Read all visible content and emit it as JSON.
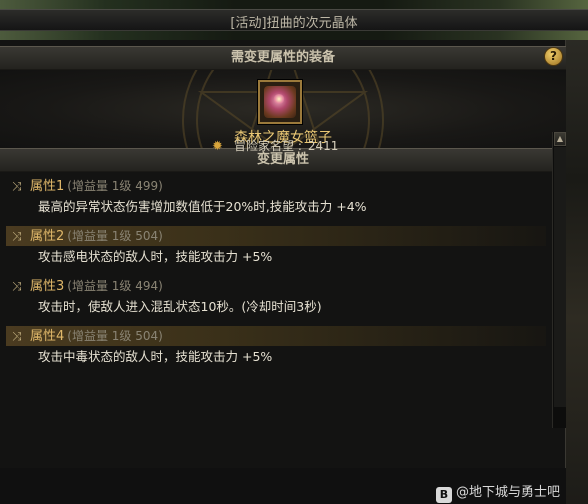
{
  "window": {
    "title": "[活动]扭曲的次元晶体"
  },
  "equip_section": {
    "header": "需变更属性的装备",
    "help_label": "?"
  },
  "item": {
    "name": "森林之魔女篮子",
    "icon": "witch-basket-icon"
  },
  "change_section": {
    "header": "变更属性"
  },
  "fame": {
    "label": "冒险家名望 :",
    "value": "2411",
    "icon": "fame-emblem-icon"
  },
  "attributes": [
    {
      "name": "属性1",
      "meta": "(增益量 1级 499)",
      "desc": "最高的异常状态伤害增加数值低于20%时,技能攻击力 +4%",
      "highlighted": false
    },
    {
      "name": "属性2",
      "meta": "(增益量 1级 504)",
      "desc": "攻击感电状态的敌人时，技能攻击力 +5%",
      "highlighted": true
    },
    {
      "name": "属性3",
      "meta": "(增益量 1级 494)",
      "desc": "攻击时，使敌人进入混乱状态10秒。(冷却时间3秒)",
      "highlighted": false
    },
    {
      "name": "属性4",
      "meta": "(增益量 1级 504)",
      "desc": "攻击中毒状态的敌人时，技能攻击力 +5%",
      "highlighted": true
    }
  ],
  "watermark": {
    "text": "@地下城与勇士吧",
    "icon_glyph": "B"
  },
  "colors": {
    "item_name": "#e9c774",
    "attr_name": "#e0b86a",
    "highlight": "#4a3b20"
  }
}
